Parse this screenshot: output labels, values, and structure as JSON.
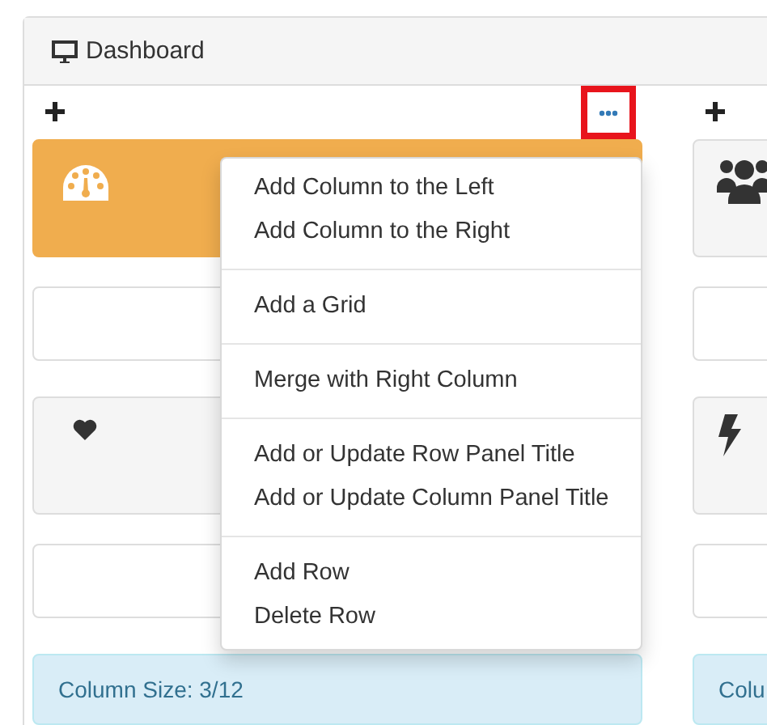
{
  "window": {
    "title": "Dashboard"
  },
  "columns": [
    {
      "menu_button": {
        "highlighted": true
      },
      "cells": [
        {
          "kind": "tile",
          "color": "#f0ad4e"
        },
        {
          "kind": "box"
        },
        {
          "kind": "tile",
          "color": "#f5f5f5"
        },
        {
          "kind": "box"
        },
        {
          "kind": "info",
          "text": "Column Size: 3/12"
        }
      ]
    },
    {
      "cells": [
        {
          "kind": "tile",
          "color": "#f5f5f5"
        },
        {
          "kind": "box"
        },
        {
          "kind": "tile",
          "color": "#f5f5f5"
        },
        {
          "kind": "box"
        },
        {
          "kind": "info",
          "text": "Colu"
        }
      ]
    }
  ],
  "menu": {
    "groups": [
      [
        "Add Column to the Left",
        "Add Column to the Right"
      ],
      [
        "Add a Grid"
      ],
      [
        "Merge with Right Column"
      ],
      [
        "Add or Update Row Panel Title",
        "Add or Update Column Panel Title"
      ],
      [
        "Add Row",
        "Delete Row"
      ]
    ]
  }
}
